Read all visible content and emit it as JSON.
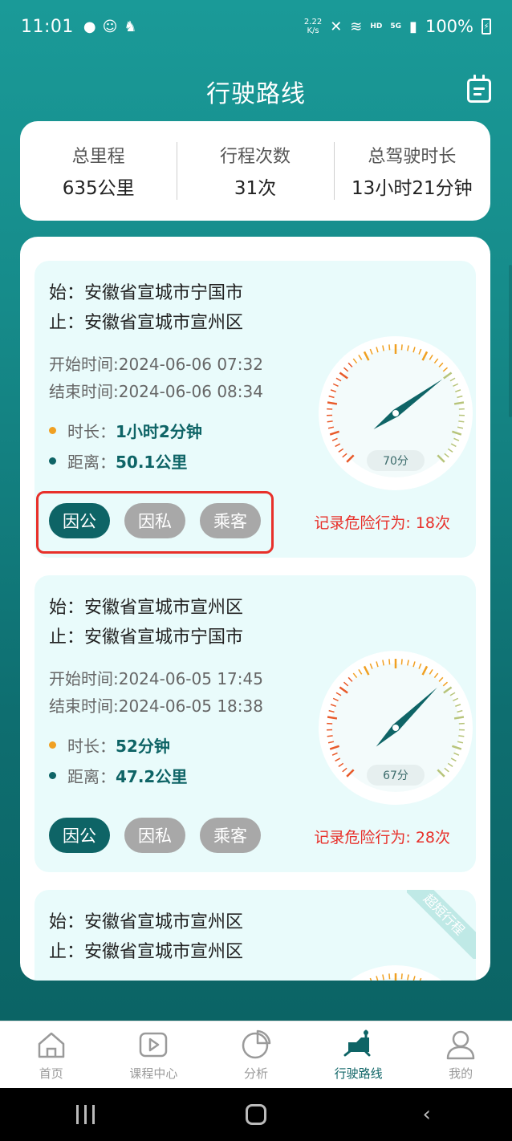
{
  "status_bar": {
    "time": "11:01",
    "net_speed_value": "2.22",
    "net_speed_unit": "K/s",
    "network_badge": "HD",
    "signal_badge": "5G",
    "battery": "100%"
  },
  "header": {
    "title": "行驶路线"
  },
  "summary": [
    {
      "label": "总里程",
      "value": "635公里"
    },
    {
      "label": "行程次数",
      "value": "31次"
    },
    {
      "label": "总驾驶时长",
      "value": "13小时21分钟"
    }
  ],
  "trips": [
    {
      "start": "始：安徽省宣城市宁国市",
      "end": "止：安徽省宣城市宣州区",
      "start_time": "开始时间:2024-06-06 07:32",
      "end_time": "结束时间:2024-06-06 08:34",
      "duration_label": "时长：",
      "duration": "1小时2分钟",
      "distance_label": "距离：",
      "distance": "50.1公里",
      "tags": [
        "因公",
        "因私",
        "乘客"
      ],
      "active_tag": "因公",
      "danger": "记录危险行为: 18次",
      "score": "70分",
      "score_value": 70
    },
    {
      "start": "始：安徽省宣城市宣州区",
      "end": "止：安徽省宣城市宁国市",
      "start_time": "开始时间:2024-06-05 17:45",
      "end_time": "结束时间:2024-06-05 18:38",
      "duration_label": "时长：",
      "duration": "52分钟",
      "distance_label": "距离：",
      "distance": "47.2公里",
      "tags": [
        "因公",
        "因私",
        "乘客"
      ],
      "active_tag": "因公",
      "danger": "记录危险行为: 28次",
      "score": "67分",
      "score_value": 67
    },
    {
      "start": "始：安徽省宣城市宣州区",
      "end": "止：安徽省宣城市宣州区",
      "ribbon": "超短行程"
    }
  ],
  "tabbar": [
    {
      "label": "首页",
      "icon": "home-icon"
    },
    {
      "label": "课程中心",
      "icon": "play-icon"
    },
    {
      "label": "分析",
      "icon": "pie-chart-icon"
    },
    {
      "label": "行驶路线",
      "icon": "route-icon",
      "active": true
    },
    {
      "label": "我的",
      "icon": "user-icon"
    }
  ],
  "colors": {
    "primary": "#0e6466",
    "danger": "#e8302a",
    "card_bg": "#e9fbfb"
  }
}
